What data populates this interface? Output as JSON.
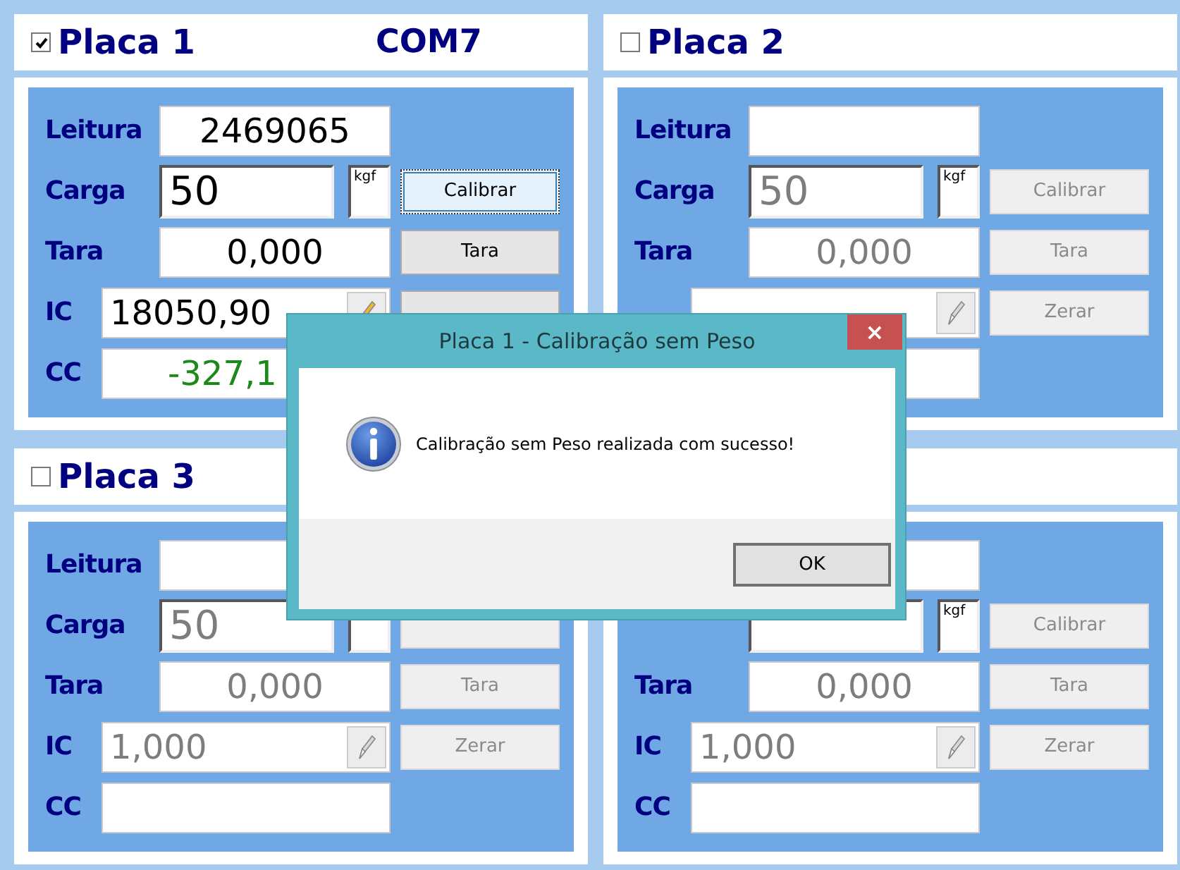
{
  "panels": [
    {
      "title": "Placa 1",
      "checked": true,
      "port": "COM7",
      "disabled": false,
      "rows": [
        {
          "kind": "reading",
          "label": "Leitura",
          "value": "2469065"
        },
        {
          "kind": "load",
          "label": "Carga",
          "value": "50",
          "unit": "kgf",
          "button": "Calibrar",
          "focused": true
        },
        {
          "kind": "tare",
          "label": "Tara",
          "value": "0,000",
          "button": "Tara"
        },
        {
          "kind": "coef",
          "label": "IC",
          "value": "18050,90"
        },
        {
          "kind": "offset",
          "label": "CC",
          "value": "-327,1"
        }
      ]
    },
    {
      "title": "Placa 2",
      "checked": false,
      "disabled": true,
      "rows": [
        {
          "kind": "reading",
          "label": "Leitura"
        },
        {
          "kind": "load",
          "label": "Carga",
          "value": "50",
          "unit": "kgf",
          "button": "Calibrar",
          "focused": false
        },
        {
          "kind": "tare",
          "label": "Tara",
          "value": "0,000",
          "button": "Tara"
        },
        {
          "kind": "coef",
          "button": "Zerar"
        },
        {
          "kind": "offset"
        }
      ]
    },
    {
      "title": "Placa 3",
      "checked": false,
      "disabled": true,
      "rows": [
        {
          "kind": "reading",
          "label": "Leitura"
        },
        {
          "kind": "load",
          "label": "Carga",
          "value": "50",
          "focused": false
        },
        {
          "kind": "tare",
          "label": "Tara",
          "value": "0,000",
          "button": "Tara"
        },
        {
          "kind": "coef",
          "label": "IC",
          "value": "1,000",
          "button": "Zerar"
        },
        {
          "kind": "offset",
          "label": "CC"
        }
      ]
    },
    {
      "disabled": true,
      "rows": [
        {
          "kind": "reading"
        },
        {
          "kind": "load",
          "unit": "kgf",
          "button": "Calibrar",
          "focused": false
        },
        {
          "kind": "tare",
          "label": "Tara",
          "value": "0,000",
          "button": "Tara"
        },
        {
          "kind": "coef",
          "label": "IC",
          "value": "1,000",
          "button": "Zerar"
        },
        {
          "kind": "offset",
          "label": "CC"
        }
      ]
    }
  ],
  "dialog": {
    "title": "Placa 1 - Calibração sem Peso",
    "close": "×",
    "message": "Calibração sem Peso realizada com sucesso!",
    "button": "OK"
  }
}
